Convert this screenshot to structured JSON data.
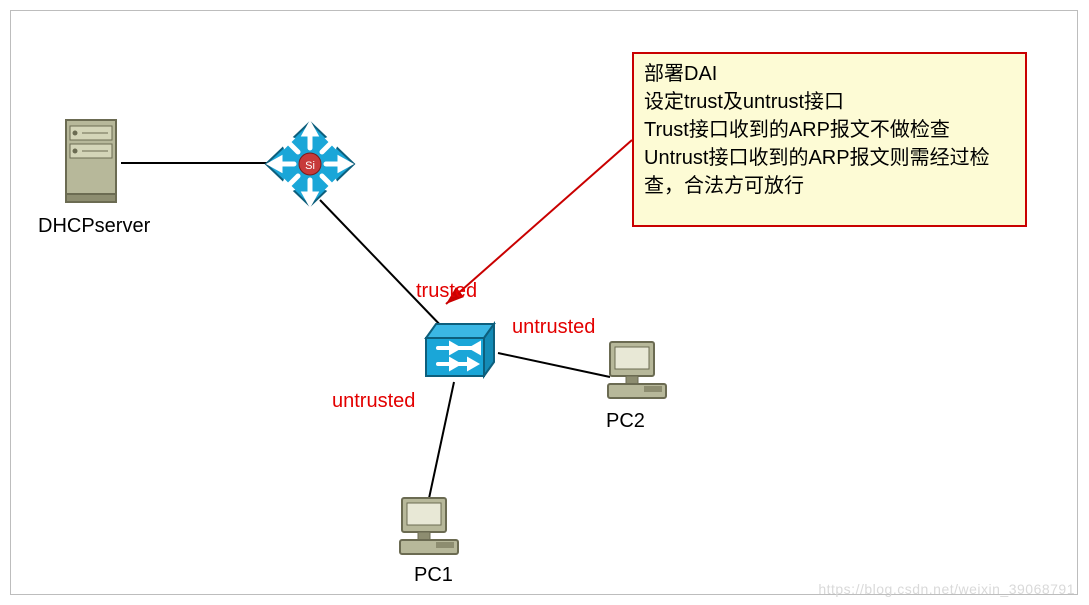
{
  "nodes": {
    "dhcp_server": {
      "label": "DHCPserver"
    },
    "core_switch": {
      "label": ""
    },
    "access_switch": {
      "label": ""
    },
    "pc1": {
      "label": "PC1"
    },
    "pc2": {
      "label": "PC2"
    }
  },
  "ports": {
    "uplink": {
      "label": "trusted",
      "trust": true
    },
    "to_pc1": {
      "label": "untrusted",
      "trust": false
    },
    "to_pc2": {
      "label": "untrusted",
      "trust": false
    }
  },
  "callout": {
    "l1": "部署DAI",
    "l2": "设定trust及untrust接口",
    "l3": "Trust接口收到的ARP报文不做检查",
    "l4": "Untrust接口收到的ARP报文则需经过检查，合法方可放行"
  },
  "watermark": "https://blog.csdn.net/weixin_39068791"
}
